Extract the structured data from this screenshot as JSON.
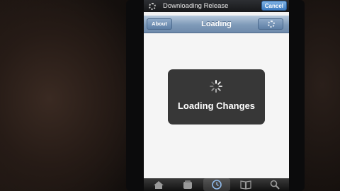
{
  "status_bar": {
    "text": "Downloading Release",
    "cancel_label": "Cancel"
  },
  "nav_bar": {
    "title": "Loading",
    "about_label": "About"
  },
  "hud": {
    "label": "Loading Changes"
  },
  "tab_bar": {
    "tabs": [
      {
        "icon": "home-icon"
      },
      {
        "icon": "package-icon"
      },
      {
        "icon": "clock-icon",
        "active": true
      },
      {
        "icon": "book-icon"
      },
      {
        "icon": "search-icon"
      }
    ]
  },
  "colors": {
    "nav_bar": "#7f9ab8",
    "cancel_button": "#3d7cc1",
    "hud_background": "#262626",
    "status_bar": "#17181a"
  }
}
